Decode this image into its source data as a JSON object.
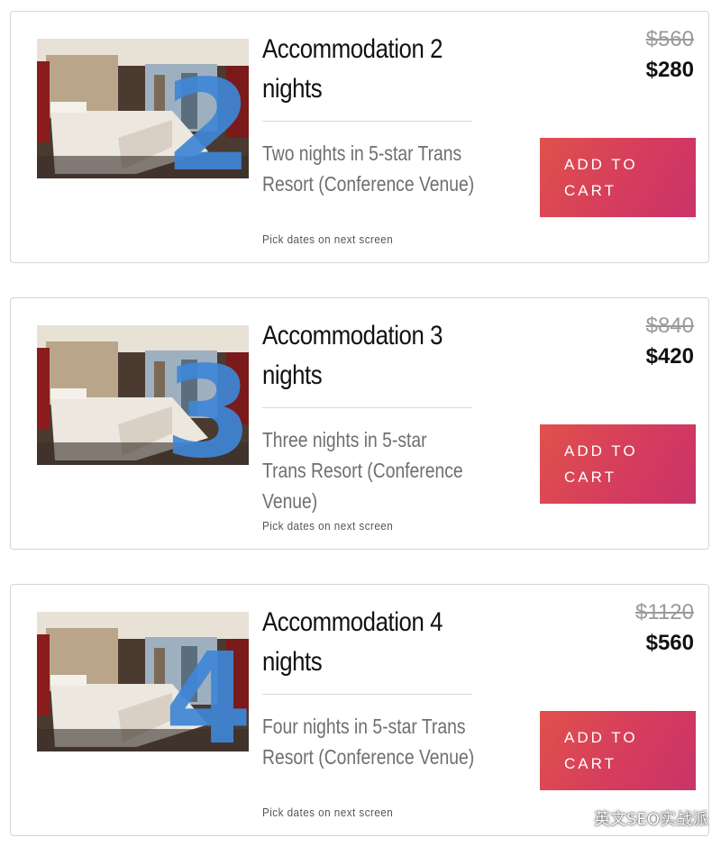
{
  "products": [
    {
      "title_line1": "Accommodation 2",
      "title_line2": "nights",
      "description": "Two nights in 5-star Trans Resort (Conference Venue)",
      "note": "Pick dates on next screen",
      "original_price": "$560",
      "sale_price": "$280",
      "overlay_number": "2",
      "button_line1": "ADD TO",
      "button_line2": "CART"
    },
    {
      "title_line1": "Accommodation 3",
      "title_line2": "nights",
      "description": "Three nights in 5-star Trans Resort (Conference Venue)",
      "note": "Pick dates on next screen",
      "original_price": "$840",
      "sale_price": "$420",
      "overlay_number": "3",
      "button_line1": "ADD TO",
      "button_line2": "CART"
    },
    {
      "title_line1": "Accommodation 4",
      "title_line2": "nights",
      "description": "Four nights in 5-star Trans Resort (Conference Venue)",
      "note": "Pick dates on next screen",
      "original_price": "$1120",
      "sale_price": "$560",
      "overlay_number": "4",
      "button_line1": "ADD TO",
      "button_line2": "CART"
    }
  ],
  "watermark": {
    "text": "英文SEO实战派",
    "icon": "wechat-icon"
  },
  "colors": {
    "button_gradient_start": "#e0514b",
    "button_gradient_end": "#c93468",
    "overlay_number": "#3f86d6",
    "strike_price": "#9a9a9a"
  }
}
